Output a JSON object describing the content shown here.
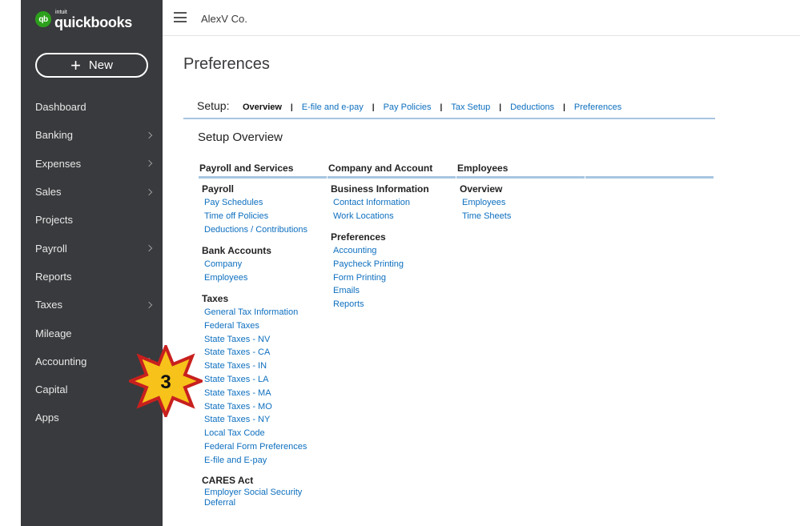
{
  "sidebar": {
    "logo_badge": "qb",
    "logo_small": "intuit",
    "logo_name": "quickbooks",
    "new_button": {
      "icon": "plus-icon",
      "label": "New"
    },
    "items": [
      {
        "label": "Dashboard",
        "chevron": false
      },
      {
        "label": "Banking",
        "chevron": true
      },
      {
        "label": "Expenses",
        "chevron": true
      },
      {
        "label": "Sales",
        "chevron": true
      },
      {
        "label": "Projects",
        "chevron": false
      },
      {
        "label": "Payroll",
        "chevron": true
      },
      {
        "label": "Reports",
        "chevron": false
      },
      {
        "label": "Taxes",
        "chevron": true
      },
      {
        "label": "Mileage",
        "chevron": false
      },
      {
        "label": "Accounting",
        "chevron": true
      },
      {
        "label": "Capital",
        "chevron": false
      },
      {
        "label": "Apps",
        "chevron": false
      }
    ]
  },
  "topbar": {
    "menu_icon": "hamburger-icon",
    "company": "AlexV Co."
  },
  "page_title": "Preferences",
  "setup": {
    "label": "Setup:",
    "tabs": [
      "Overview",
      "E-file and e-pay",
      "Pay Policies",
      "Tax Setup",
      "Deductions",
      "Preferences"
    ],
    "active": "Overview"
  },
  "overview_title": "Setup Overview",
  "columns": {
    "col1": {
      "title": "Payroll and Services",
      "sections": [
        {
          "heading": "Payroll",
          "links": [
            "Pay Schedules",
            "Time off Policies",
            "Deductions / Contributions"
          ]
        },
        {
          "heading": "Bank Accounts",
          "links": [
            "Company",
            "Employees"
          ]
        },
        {
          "heading": "Taxes",
          "links": [
            "General Tax Information",
            "Federal Taxes",
            "State Taxes - NV",
            "State Taxes - CA",
            "State Taxes - IN",
            "State Taxes - LA",
            "State Taxes - MA",
            "State Taxes - MO",
            "State Taxes - NY",
            "Local Tax Code",
            "Federal Form Preferences",
            "E-file and E-pay"
          ]
        },
        {
          "heading": "CARES Act",
          "links": [
            "Employer Social Security Deferral"
          ]
        }
      ]
    },
    "col2": {
      "title": "Company and Account",
      "sections": [
        {
          "heading": "Business Information",
          "links": [
            "Contact Information",
            "Work Locations"
          ]
        },
        {
          "heading": "Preferences",
          "links": [
            "Accounting",
            "Paycheck Printing",
            "Form Printing",
            "Emails",
            "Reports"
          ]
        }
      ]
    },
    "col3": {
      "title": "Employees",
      "sections": [
        {
          "heading": "Overview",
          "links": [
            "Employees",
            "Time Sheets"
          ]
        }
      ]
    },
    "col4": {
      "title": ""
    }
  },
  "step_badge": {
    "number": "3",
    "fill": "#f7c21a",
    "outline": "#c8201e"
  },
  "colors": {
    "sidebar": "#393a3d",
    "link": "#0d6fbf",
    "rule": "#a7c6e1",
    "brand": "#2ca01c"
  }
}
